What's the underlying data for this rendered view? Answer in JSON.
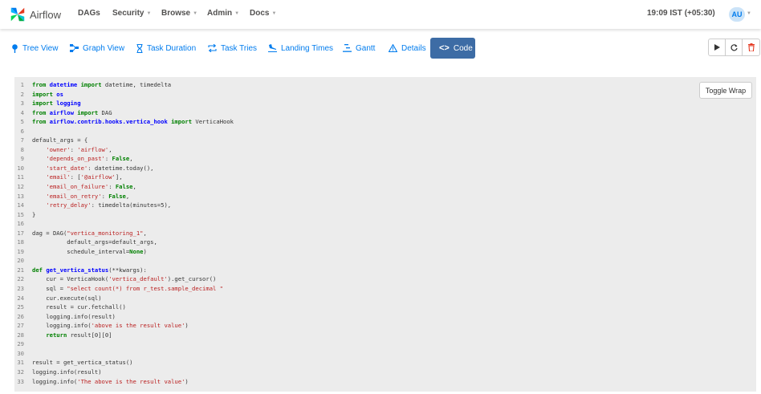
{
  "brand": {
    "name": "Airflow"
  },
  "nav": {
    "items": [
      {
        "label": "DAGs",
        "has_caret": false
      },
      {
        "label": "Security",
        "has_caret": true
      },
      {
        "label": "Browse",
        "has_caret": true
      },
      {
        "label": "Admin",
        "has_caret": true
      },
      {
        "label": "Docs",
        "has_caret": true
      }
    ],
    "time": "19:09 IST (+05:30)",
    "user_initials": "AU"
  },
  "tabs": [
    {
      "label": "Tree View",
      "icon": "tree-icon"
    },
    {
      "label": "Graph View",
      "icon": "graph-icon"
    },
    {
      "label": "Task Duration",
      "icon": "hourglass-icon"
    },
    {
      "label": "Task Tries",
      "icon": "retry-icon"
    },
    {
      "label": "Landing Times",
      "icon": "plane-landing-icon"
    },
    {
      "label": "Gantt",
      "icon": "gantt-icon"
    },
    {
      "label": "Details",
      "icon": "warning-triangle-icon"
    },
    {
      "label": "Code",
      "icon": "code-icon",
      "active": true
    }
  ],
  "actions": [
    "play-icon",
    "refresh-icon",
    "trash-icon"
  ],
  "toggle_wrap_label": "Toggle Wrap",
  "colors": {
    "active_tab": "#3d6ca5",
    "link": "#017cee",
    "keyword": "#008000",
    "module": "#0000ff",
    "string": "#ba2121",
    "delete": "#e43921"
  },
  "code_lines": [
    [
      [
        "kw",
        "from"
      ],
      [
        "txt",
        " "
      ],
      [
        "mod",
        "datetime"
      ],
      [
        "txt",
        " "
      ],
      [
        "kw",
        "import"
      ],
      [
        "txt",
        " datetime, timedelta"
      ]
    ],
    [
      [
        "kw",
        "import"
      ],
      [
        "txt",
        " "
      ],
      [
        "mod",
        "os"
      ]
    ],
    [
      [
        "kw",
        "import"
      ],
      [
        "txt",
        " "
      ],
      [
        "mod",
        "logging"
      ]
    ],
    [
      [
        "kw",
        "from"
      ],
      [
        "txt",
        " "
      ],
      [
        "mod",
        "airflow"
      ],
      [
        "txt",
        " "
      ],
      [
        "kw",
        "import"
      ],
      [
        "txt",
        " DAG"
      ]
    ],
    [
      [
        "kw",
        "from"
      ],
      [
        "txt",
        " "
      ],
      [
        "mod",
        "airflow.contrib.hooks.vertica_hook"
      ],
      [
        "txt",
        " "
      ],
      [
        "kw",
        "import"
      ],
      [
        "txt",
        " VerticaHook"
      ]
    ],
    [],
    [
      [
        "txt",
        "default_args = {"
      ]
    ],
    [
      [
        "txt",
        "    "
      ],
      [
        "str",
        "'owner'"
      ],
      [
        "txt",
        ": "
      ],
      [
        "str",
        "'airflow'"
      ],
      [
        "txt",
        ","
      ]
    ],
    [
      [
        "txt",
        "    "
      ],
      [
        "str",
        "'depends_on_past'"
      ],
      [
        "txt",
        ": "
      ],
      [
        "kw",
        "False"
      ],
      [
        "txt",
        ","
      ]
    ],
    [
      [
        "txt",
        "    "
      ],
      [
        "str",
        "'start_date'"
      ],
      [
        "txt",
        ": datetime.today(),"
      ]
    ],
    [
      [
        "txt",
        "    "
      ],
      [
        "str",
        "'email'"
      ],
      [
        "txt",
        ": ["
      ],
      [
        "str",
        "'@airflow'"
      ],
      [
        "txt",
        "],"
      ]
    ],
    [
      [
        "txt",
        "    "
      ],
      [
        "str",
        "'email_on_failure'"
      ],
      [
        "txt",
        ": "
      ],
      [
        "kw",
        "False"
      ],
      [
        "txt",
        ","
      ]
    ],
    [
      [
        "txt",
        "    "
      ],
      [
        "str",
        "'email_on_retry'"
      ],
      [
        "txt",
        ": "
      ],
      [
        "kw",
        "False"
      ],
      [
        "txt",
        ","
      ]
    ],
    [
      [
        "txt",
        "    "
      ],
      [
        "str",
        "'retry_delay'"
      ],
      [
        "txt",
        ": timedelta(minutes=5),"
      ]
    ],
    [
      [
        "txt",
        "}"
      ]
    ],
    [],
    [
      [
        "txt",
        "dag = DAG("
      ],
      [
        "str",
        "\"vertica_monitoring_1\""
      ],
      [
        "txt",
        ","
      ]
    ],
    [
      [
        "txt",
        "          default_args=default_args,"
      ]
    ],
    [
      [
        "txt",
        "          schedule_interval="
      ],
      [
        "kw",
        "None"
      ],
      [
        "txt",
        ")"
      ]
    ],
    [],
    [
      [
        "kw",
        "def"
      ],
      [
        "txt",
        " "
      ],
      [
        "fn",
        "get_vertica_status"
      ],
      [
        "txt",
        "(**kwargs):"
      ]
    ],
    [
      [
        "txt",
        "    cur = VerticaHook("
      ],
      [
        "str",
        "'vertica_default'"
      ],
      [
        "txt",
        ").get_cursor()"
      ]
    ],
    [
      [
        "txt",
        "    sql = "
      ],
      [
        "str",
        "\"select count(*) from r_test.sample_decimal \""
      ]
    ],
    [
      [
        "txt",
        "    cur.execute(sql)"
      ]
    ],
    [
      [
        "txt",
        "    result = cur.fetchall()"
      ]
    ],
    [
      [
        "txt",
        "    logging.info(result)"
      ]
    ],
    [
      [
        "txt",
        "    logging.info("
      ],
      [
        "str",
        "'above is the result value'"
      ],
      [
        "txt",
        ")"
      ]
    ],
    [
      [
        "txt",
        "    "
      ],
      [
        "kw",
        "return"
      ],
      [
        "txt",
        " result[0][0]"
      ]
    ],
    [],
    [],
    [
      [
        "txt",
        "result = get_vertica_status()"
      ]
    ],
    [
      [
        "txt",
        "logging.info(result)"
      ]
    ],
    [
      [
        "txt",
        "logging.info("
      ],
      [
        "str",
        "'The above is the result value'"
      ],
      [
        "txt",
        ")"
      ]
    ]
  ]
}
